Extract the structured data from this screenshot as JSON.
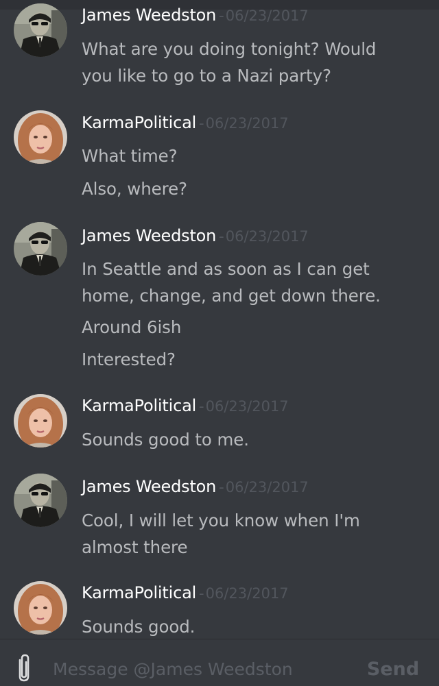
{
  "conversation": {
    "groups": [
      {
        "author": "James Weedston",
        "timestamp": "06/23/2017",
        "separator": "-",
        "lines": [
          "What are you doing tonight? Would",
          "you like to go to a Nazi party?"
        ]
      },
      {
        "author": "KarmaPolitical",
        "timestamp": "06/23/2017",
        "separator": "-",
        "lines": [
          "What time?",
          "Also, where?"
        ]
      },
      {
        "author": "James Weedston",
        "timestamp": "06/23/2017",
        "separator": "-",
        "lines": [
          "In Seattle and as soon as I can get",
          "home, change, and get down there.",
          "Around 6ish",
          "Interested?"
        ]
      },
      {
        "author": "KarmaPolitical",
        "timestamp": "06/23/2017",
        "separator": "-",
        "lines": [
          "Sounds good to me."
        ]
      },
      {
        "author": "James Weedston",
        "timestamp": "06/23/2017",
        "separator": "-",
        "lines": [
          "Cool, I will let you know when I'm",
          "almost there"
        ]
      },
      {
        "author": "KarmaPolitical",
        "timestamp": "06/23/2017",
        "separator": "-",
        "lines": [
          "Sounds good."
        ]
      }
    ]
  },
  "composer": {
    "placeholder": "Message @James Weedston",
    "send_label": "Send",
    "attach_icon": "paperclip-icon"
  },
  "colors": {
    "background": "#36393e",
    "author": "#ffffff",
    "message_text": "#b9bbbe",
    "timestamp": "#52565d",
    "placeholder": "#5a5e65"
  }
}
